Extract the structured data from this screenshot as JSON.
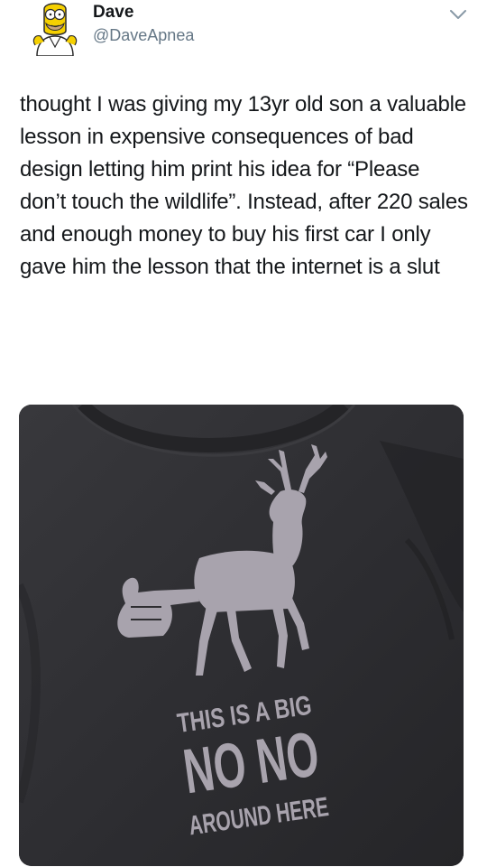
{
  "tweet": {
    "display_name": "Dave",
    "handle": "@DaveApnea",
    "text": "thought I was giving my 13yr old son a valuable lesson in expensive consequences of bad design letting him print his idea for “Please don’t touch the wildlife”. Instead, after 220 sales and enough money to buy his first car I only gave him the lesson that the internet is a slut",
    "menu_icon": "chevron-down-icon",
    "avatar_icon": "cartoon-avatar-icon"
  },
  "shirt": {
    "line1": "THIS IS A BIG",
    "line2": "NO NO",
    "line3": "AROUND HERE",
    "shirt_color": "#2e2e31",
    "print_color": "#a8a3ad"
  }
}
